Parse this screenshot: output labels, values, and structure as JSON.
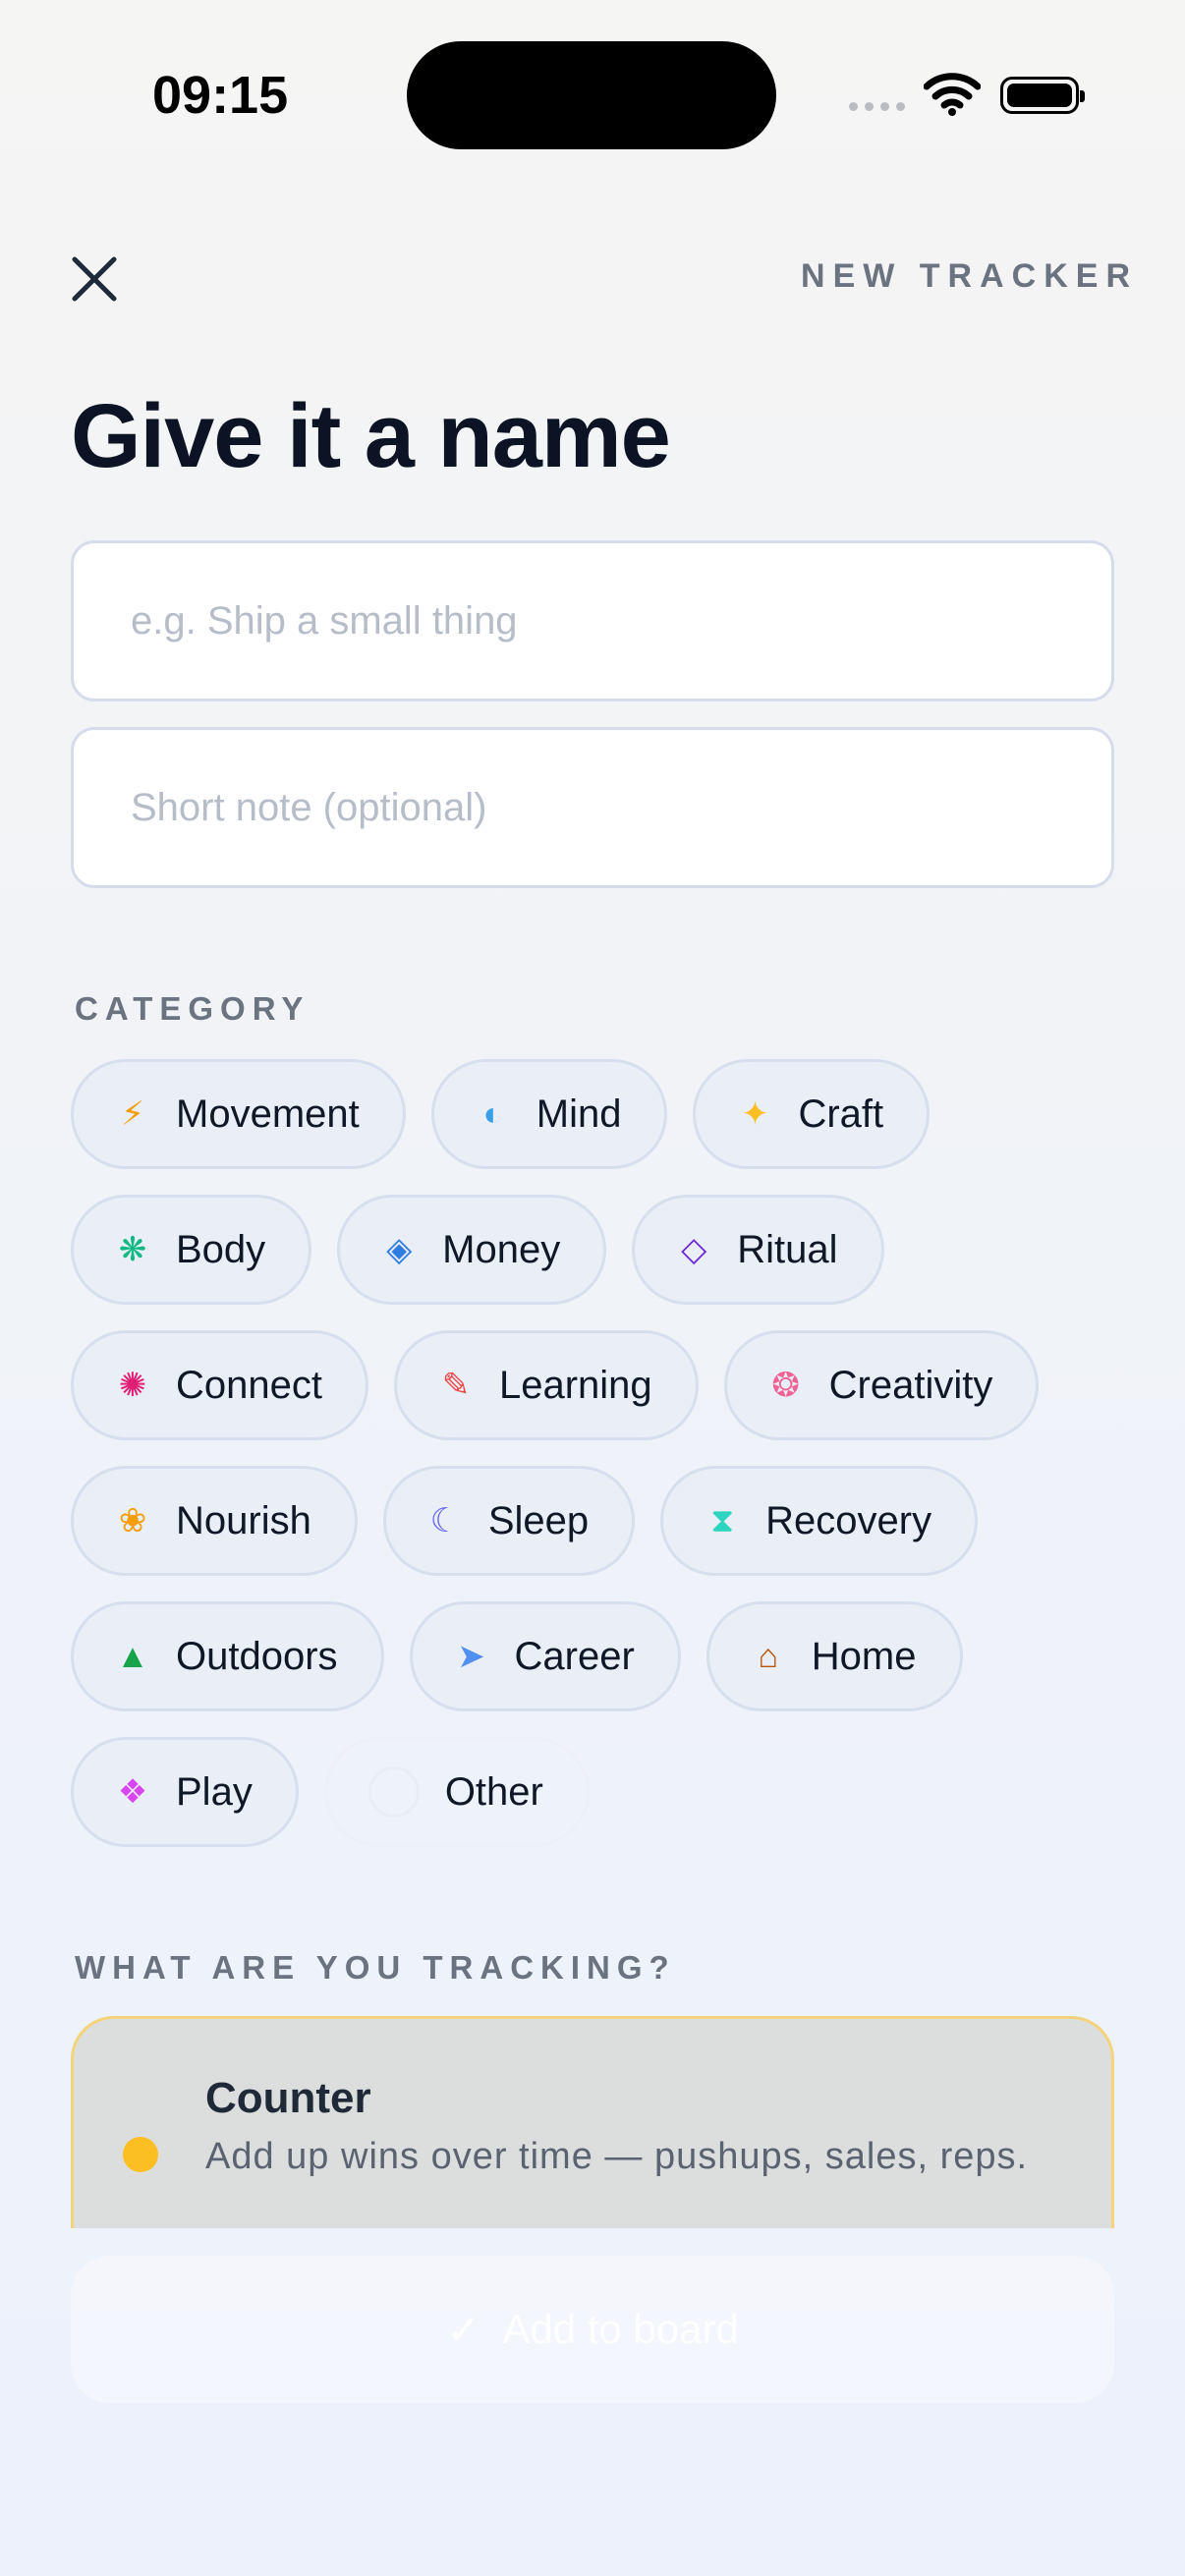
{
  "status_bar": {
    "time": "09:15"
  },
  "header": {
    "eyebrow": "NEW TRACKER",
    "title": "Give it a name"
  },
  "form": {
    "name_placeholder": "e.g. Ship a small thing",
    "note_placeholder": "Short note (optional)"
  },
  "category": {
    "label": "CATEGORY",
    "chips": [
      {
        "label": "Movement",
        "icon": "lightning-icon",
        "glyph": "⚡",
        "color": "#f59e0b"
      },
      {
        "label": "Mind",
        "icon": "half-circle-icon",
        "glyph": "◐",
        "color": "#38a0e8"
      },
      {
        "label": "Craft",
        "icon": "sparkle-icon",
        "glyph": "✦",
        "color": "#fbbf24"
      },
      {
        "label": "Body",
        "icon": "asterisk-icon",
        "glyph": "❋",
        "color": "#10b981"
      },
      {
        "label": "Money",
        "icon": "diamond-icon",
        "glyph": "◈",
        "color": "#2f7de1"
      },
      {
        "label": "Ritual",
        "icon": "diamond-outline-icon",
        "glyph": "◇",
        "color": "#6d28d9"
      },
      {
        "label": "Connect",
        "icon": "burst-icon",
        "glyph": "✺",
        "color": "#e11d74"
      },
      {
        "label": "Learning",
        "icon": "pencil-icon",
        "glyph": "✎",
        "color": "#ef4444"
      },
      {
        "label": "Creativity",
        "icon": "flower-ring-icon",
        "glyph": "❂",
        "color": "#f06292"
      },
      {
        "label": "Nourish",
        "icon": "flower-icon",
        "glyph": "❀",
        "color": "#f59e0b"
      },
      {
        "label": "Sleep",
        "icon": "moon-icon",
        "glyph": "☾",
        "color": "#6366f1"
      },
      {
        "label": "Recovery",
        "icon": "hourglass-icon",
        "glyph": "⧗",
        "color": "#2dd4bf"
      },
      {
        "label": "Outdoors",
        "icon": "triangle-icon",
        "glyph": "▲",
        "color": "#16a34a"
      },
      {
        "label": "Career",
        "icon": "arrow-icon",
        "glyph": "➤",
        "color": "#4f8ff0"
      },
      {
        "label": "Home",
        "icon": "house-icon",
        "glyph": "⌂",
        "color": "#b45309"
      },
      {
        "label": "Play",
        "icon": "play-diamond-icon",
        "glyph": "❖",
        "color": "#d946ef"
      },
      {
        "label": "Other",
        "icon": "circle-icon",
        "glyph": "",
        "color": "#e5e7eb"
      }
    ]
  },
  "tracking": {
    "label": "WHAT ARE YOU TRACKING?",
    "option": {
      "title": "Counter",
      "description": "Add up wins over time — pushups, sales, reps.",
      "accent": "#fbbf24"
    }
  },
  "footer": {
    "button_label": "Add to board",
    "icon": "check-icon"
  }
}
